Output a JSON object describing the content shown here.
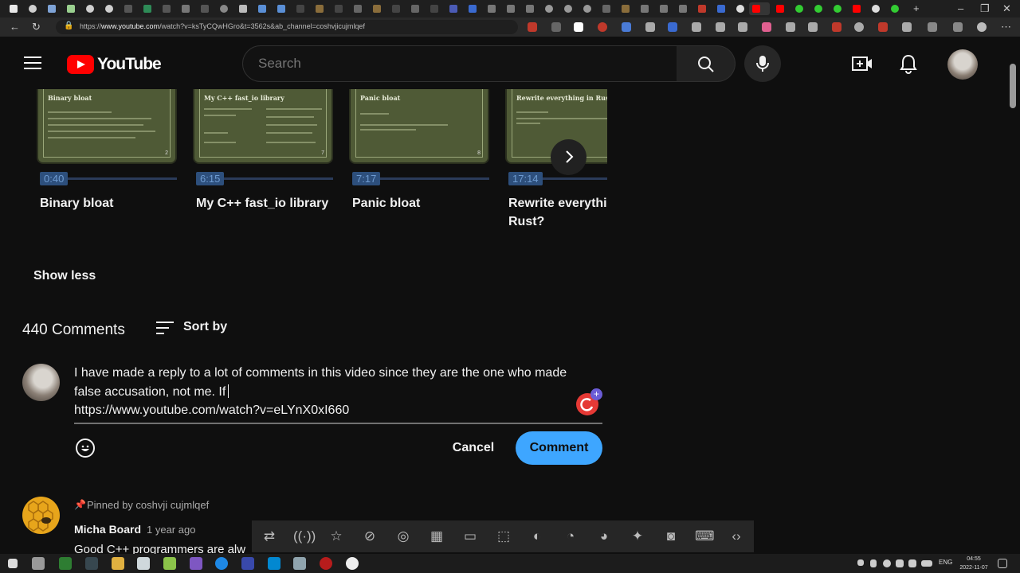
{
  "browser": {
    "url_prefix": "https://",
    "url_host": "www.youtube.com",
    "url_rest": "/watch?v=ksTyCQwHGro&t=3562s&ab_channel=coshvjicujmlqef"
  },
  "header": {
    "logo_text": "YouTube",
    "search_placeholder": "Search"
  },
  "chapters": [
    {
      "title": "Binary bloat",
      "time": "0:40",
      "thumb_title": "Binary bloat",
      "thumb_num": "2"
    },
    {
      "title": "My C++ fast_io library",
      "time": "6:15",
      "thumb_title": "My C++ fast_io library",
      "thumb_num": "7"
    },
    {
      "title": "Panic bloat",
      "time": "7:17",
      "thumb_title": "Panic bloat",
      "thumb_num": "8"
    },
    {
      "title": "Rewrite everything in Rust?",
      "time": "17:14",
      "thumb_title": "Rewrite everything in Rust?",
      "thumb_num": ""
    }
  ],
  "show_less": "Show less",
  "comments": {
    "count_label": "440 Comments",
    "sort_label": "Sort by",
    "draft_line1": "I have made a reply to a lot of comments in this video since they are the one who made",
    "draft_line2": "false accusation, not me. If",
    "draft_line3": "https://www.youtube.com/watch?v=eLYnX0xI660",
    "cancel_label": "Cancel",
    "submit_label": "Comment",
    "pinned": {
      "pinned_label": "Pinned by coshvji cujmlqef",
      "author": "Micha Board",
      "age": "1 year ago",
      "text": "Good C++ programmers are alw"
    }
  },
  "taskbar": {
    "lang": "ENG",
    "time": "04:55",
    "date": "2022-11-07"
  },
  "colors": {
    "accent": "#3ea6ff",
    "brand_red": "#ff0000",
    "background": "#0f0f0f"
  }
}
